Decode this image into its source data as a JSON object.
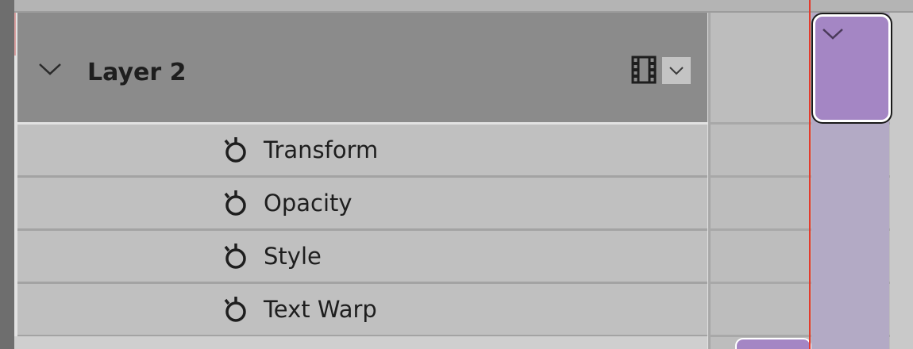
{
  "layer": {
    "name": "Layer 2",
    "expanded": true,
    "icons": [
      "chevron-down-icon",
      "film-icon",
      "chevron-down-icon"
    ]
  },
  "properties": [
    {
      "label": "Transform",
      "icon": "stopwatch-icon"
    },
    {
      "label": "Opacity",
      "icon": "stopwatch-icon"
    },
    {
      "label": "Style",
      "icon": "stopwatch-icon"
    },
    {
      "label": "Text Warp",
      "icon": "stopwatch-icon"
    }
  ],
  "colors": {
    "header_bg": "#8b8b8b",
    "row_bg": "#c0c0c0",
    "clip": "#a486c4",
    "playhead": "#e33a2c"
  }
}
